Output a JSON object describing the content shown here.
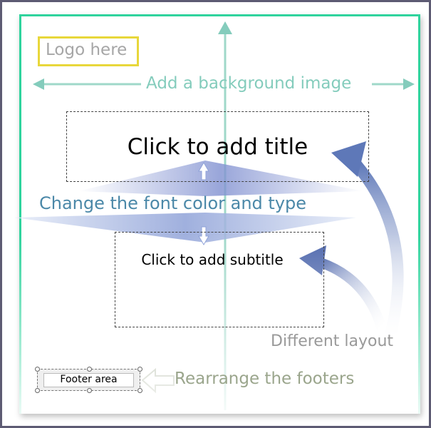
{
  "slide": {
    "logo_label": "Logo here",
    "background_hint": "Add a background image",
    "title_placeholder": "Click to add title",
    "font_hint": "Change the font color and type",
    "subtitle_placeholder": "Click to add subtitle",
    "layout_hint": "Different layout",
    "footer_label": "Footer area",
    "footer_hint": "Rearrange the footers"
  },
  "colors": {
    "slide_border": "#2fd39d",
    "logo_border": "#e8d73a",
    "arrow_teal": "#84ccbc",
    "arrow_blue": "#5e78b8",
    "font_hint": "#4b88a8"
  }
}
